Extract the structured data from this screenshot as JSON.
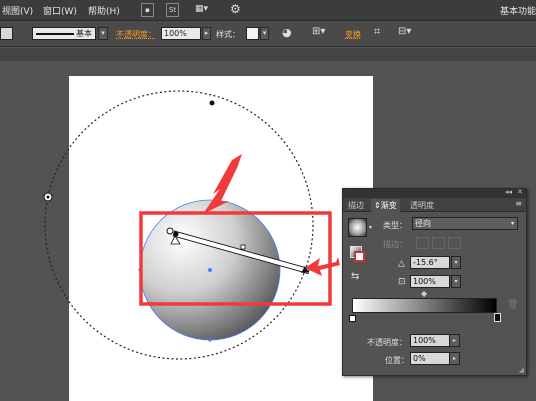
{
  "menubar": {
    "items": [
      "视图(V)",
      "窗口(W)",
      "帮助(H)"
    ],
    "st_icon": "St",
    "workspace": "基本功能"
  },
  "controlbar": {
    "stroke_profile": "基本",
    "opacity_label": "不透明度：",
    "opacity_value": "100%",
    "style_label": "样式：",
    "transform_label": "变换"
  },
  "panel": {
    "tabs": [
      "描边",
      "渐变",
      "透明度"
    ],
    "active_tab": "渐变",
    "type_label": "类型：",
    "type_value": "径向",
    "stroke_label": "描边：",
    "angle_value": "-15.6°",
    "aspect_value": "100%",
    "opacity_label": "不透明度：",
    "opacity_value": "100%",
    "location_label": "位置：",
    "location_value": "0%"
  },
  "colors": {
    "annotation_red": "#ef3b3b",
    "accent_orange": "#ff9a1f",
    "selection_blue": "#4a7bff"
  }
}
